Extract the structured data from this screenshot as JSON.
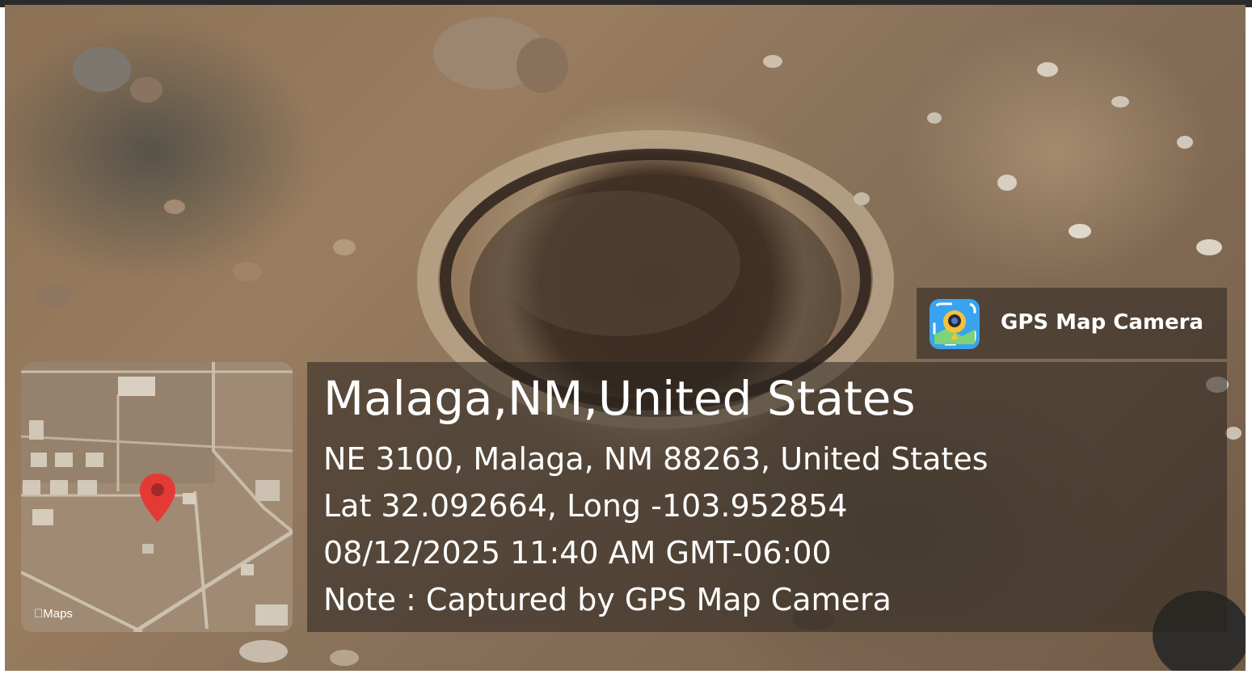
{
  "overlay": {
    "title": "Malaga,NM,United States",
    "address": "NE 3100, Malaga, NM 88263, United States",
    "coordinates": "Lat 32.092664, Long -103.952854",
    "datetime": "08/12/2025 11:40 AM GMT-06:00",
    "note": "Note : Captured by GPS Map Camera"
  },
  "badge": {
    "label": "GPS Map Camera",
    "icon": "gps-map-camera-app-icon"
  },
  "map": {
    "attribution": "Maps",
    "attribution_icon": "apple-logo-icon",
    "pin_icon": "location-pin-icon",
    "pin_color": "#e53935"
  },
  "colors": {
    "panel_bg": "#28221e",
    "text": "#ffffff",
    "soil": "#8c7156"
  }
}
